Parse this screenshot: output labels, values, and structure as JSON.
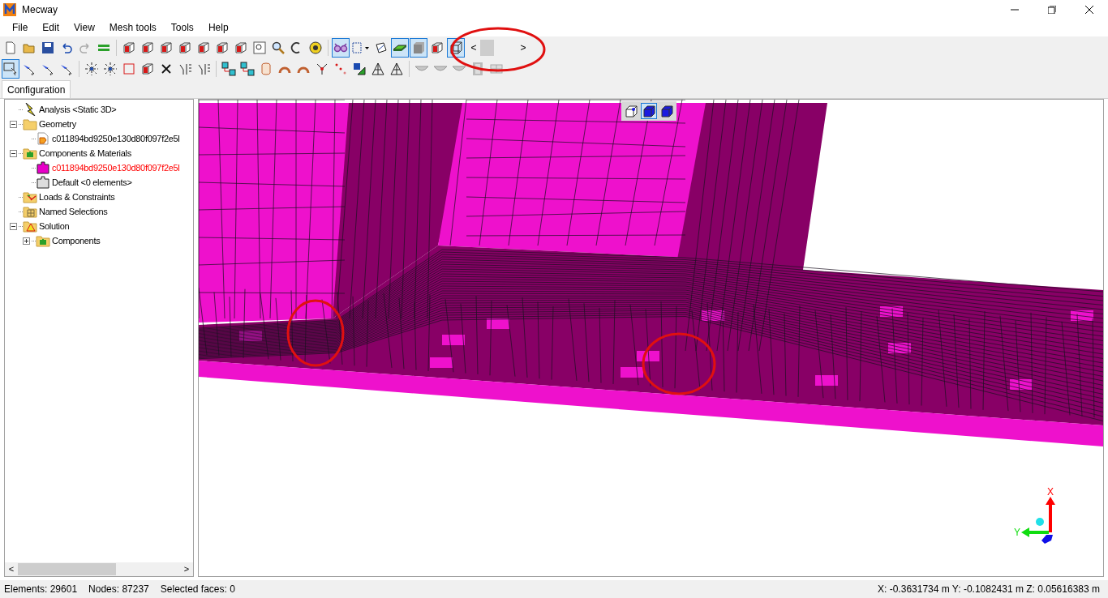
{
  "window": {
    "title": "Mecway"
  },
  "menu": [
    "File",
    "Edit",
    "View",
    "Mesh tools",
    "Tools",
    "Help"
  ],
  "toolbar_1": [
    {
      "kind": "new",
      "selected": false
    },
    {
      "kind": "open",
      "selected": false
    },
    {
      "kind": "save",
      "selected": false
    },
    {
      "kind": "undo",
      "selected": false
    },
    {
      "kind": "redo",
      "selected": false
    },
    {
      "kind": "equal",
      "selected": false
    },
    {
      "kind": "sep"
    },
    {
      "kind": "cube",
      "selected": false
    },
    {
      "kind": "cube",
      "selected": false
    },
    {
      "kind": "cube",
      "selected": false
    },
    {
      "kind": "cube",
      "selected": false
    },
    {
      "kind": "cube",
      "selected": false
    },
    {
      "kind": "cube",
      "selected": false
    },
    {
      "kind": "cube",
      "selected": false
    },
    {
      "kind": "zoom",
      "selected": false
    },
    {
      "kind": "magnifier",
      "selected": false
    },
    {
      "kind": "rotate",
      "selected": false
    },
    {
      "kind": "tape",
      "selected": false
    },
    {
      "kind": "sep"
    },
    {
      "kind": "glasses",
      "selected": true
    },
    {
      "kind": "dropdown",
      "selected": false
    },
    {
      "kind": "sketch",
      "selected": false
    },
    {
      "kind": "plate",
      "selected": true
    },
    {
      "kind": "shaded",
      "selected": true
    },
    {
      "kind": "cube",
      "selected": false
    },
    {
      "kind": "wire",
      "selected": true
    }
  ],
  "scroller": {
    "left": "<",
    "right": ">"
  },
  "toolbar_2": [
    {
      "kind": "select",
      "selected": true
    },
    {
      "kind": "pointer",
      "selected": false
    },
    {
      "kind": "pointer",
      "selected": false
    },
    {
      "kind": "pointer",
      "selected": false
    },
    {
      "kind": "sep"
    },
    {
      "kind": "star",
      "selected": false
    },
    {
      "kind": "star",
      "selected": false
    },
    {
      "kind": "square",
      "selected": false
    },
    {
      "kind": "cube",
      "selected": false
    },
    {
      "kind": "cross",
      "selected": false
    },
    {
      "kind": "bars",
      "selected": false
    },
    {
      "kind": "bars",
      "selected": false
    },
    {
      "kind": "sep"
    },
    {
      "kind": "nodes",
      "selected": false
    },
    {
      "kind": "nodes",
      "selected": false
    },
    {
      "kind": "cylinder",
      "selected": false
    },
    {
      "kind": "arc",
      "selected": false
    },
    {
      "kind": "arc",
      "selected": false
    },
    {
      "kind": "fork",
      "selected": false
    },
    {
      "kind": "dots",
      "selected": false
    },
    {
      "kind": "move",
      "selected": false
    },
    {
      "kind": "triangle",
      "selected": false
    },
    {
      "kind": "triangle",
      "selected": false
    },
    {
      "kind": "sep"
    },
    {
      "kind": "bowl",
      "selected": false
    },
    {
      "kind": "bowl",
      "selected": false
    },
    {
      "kind": "bowl",
      "selected": false
    },
    {
      "kind": "film",
      "selected": false
    },
    {
      "kind": "grid",
      "selected": false
    }
  ],
  "tabs": [
    {
      "label": "Configuration",
      "selected": true
    }
  ],
  "tree": [
    {
      "label": "Analysis <Static 3D>",
      "red": false
    },
    {
      "label": "Geometry",
      "red": false,
      "expanded": true,
      "children": [
        {
          "label": "c011894bd9250e130d80f097f2e5l",
          "red": false
        }
      ]
    },
    {
      "label": "Components & Materials",
      "red": false,
      "expanded": true,
      "children": [
        {
          "label": "c011894bd9250e130d80f097f2e5l",
          "red": true
        },
        {
          "label": "Default <0 elements>",
          "red": false
        }
      ]
    },
    {
      "label": "Loads & Constraints",
      "red": false
    },
    {
      "label": "Named Selections",
      "red": false
    },
    {
      "label": "Solution",
      "red": false,
      "expanded": true,
      "children": [
        {
          "label": "Components",
          "red": false,
          "expanded": false,
          "expandable": true
        }
      ]
    }
  ],
  "tree_scrollbar": {
    "left": "<",
    "right": ">"
  },
  "view_modes": [
    {
      "kind": "cube-point",
      "selected": false
    },
    {
      "kind": "cube-face",
      "selected": true
    },
    {
      "kind": "cube-solid",
      "selected": false
    }
  ],
  "triad": {
    "x": "X",
    "y": "Y"
  },
  "status_bar": {
    "elements": "Elements: 29601",
    "nodes": "Nodes: 87237",
    "selected": "Selected faces: 0",
    "coords": "X: -0.3631734 m Y: -0.1082431 m Z: 0.05616383 m"
  }
}
